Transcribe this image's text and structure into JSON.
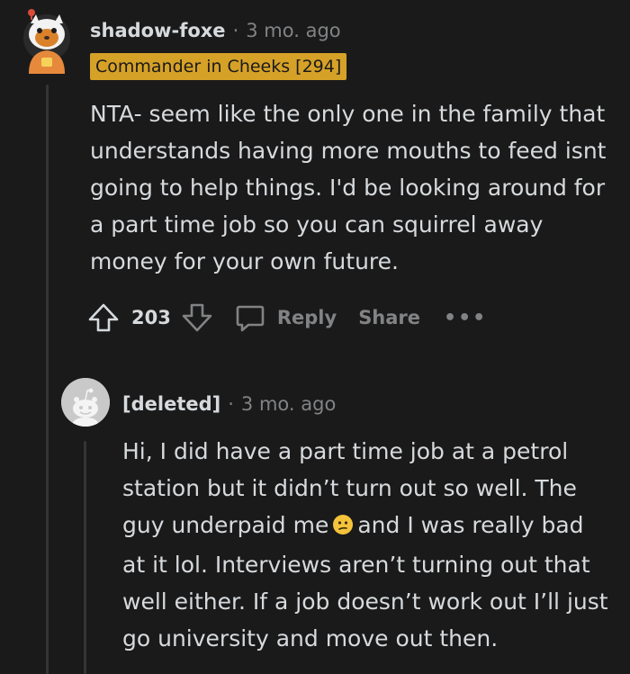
{
  "comment": {
    "author": "shadow-foxe",
    "separator": "·",
    "time": "3 mo. ago",
    "flair": "Commander in Cheeks [294]",
    "body": "NTA- seem like the only one in the family that understands having more mouths to feed isnt going to help things. I'd be looking around for a part time job so you can squirrel away money for your own future.",
    "score": "203",
    "reply_label": "Reply",
    "share_label": "Share",
    "more_label": "•••"
  },
  "reply": {
    "author": "[deleted]",
    "separator": "·",
    "time": "3 mo. ago",
    "body_part1": "Hi, I did have a part time job at a petrol station but it didn’t turn out so well. The guy underpaid me",
    "emoji": "confused-face",
    "body_part2": "and I was really bad at it lol. Interviews aren’t turning out that well either. If a job doesn’t work out I’ll just go university and move out then."
  },
  "colors": {
    "background": "#1a1a1b",
    "text": "#d7dadc",
    "muted": "#818384",
    "flair_bg": "#d6a127",
    "thread_line": "#343536"
  }
}
